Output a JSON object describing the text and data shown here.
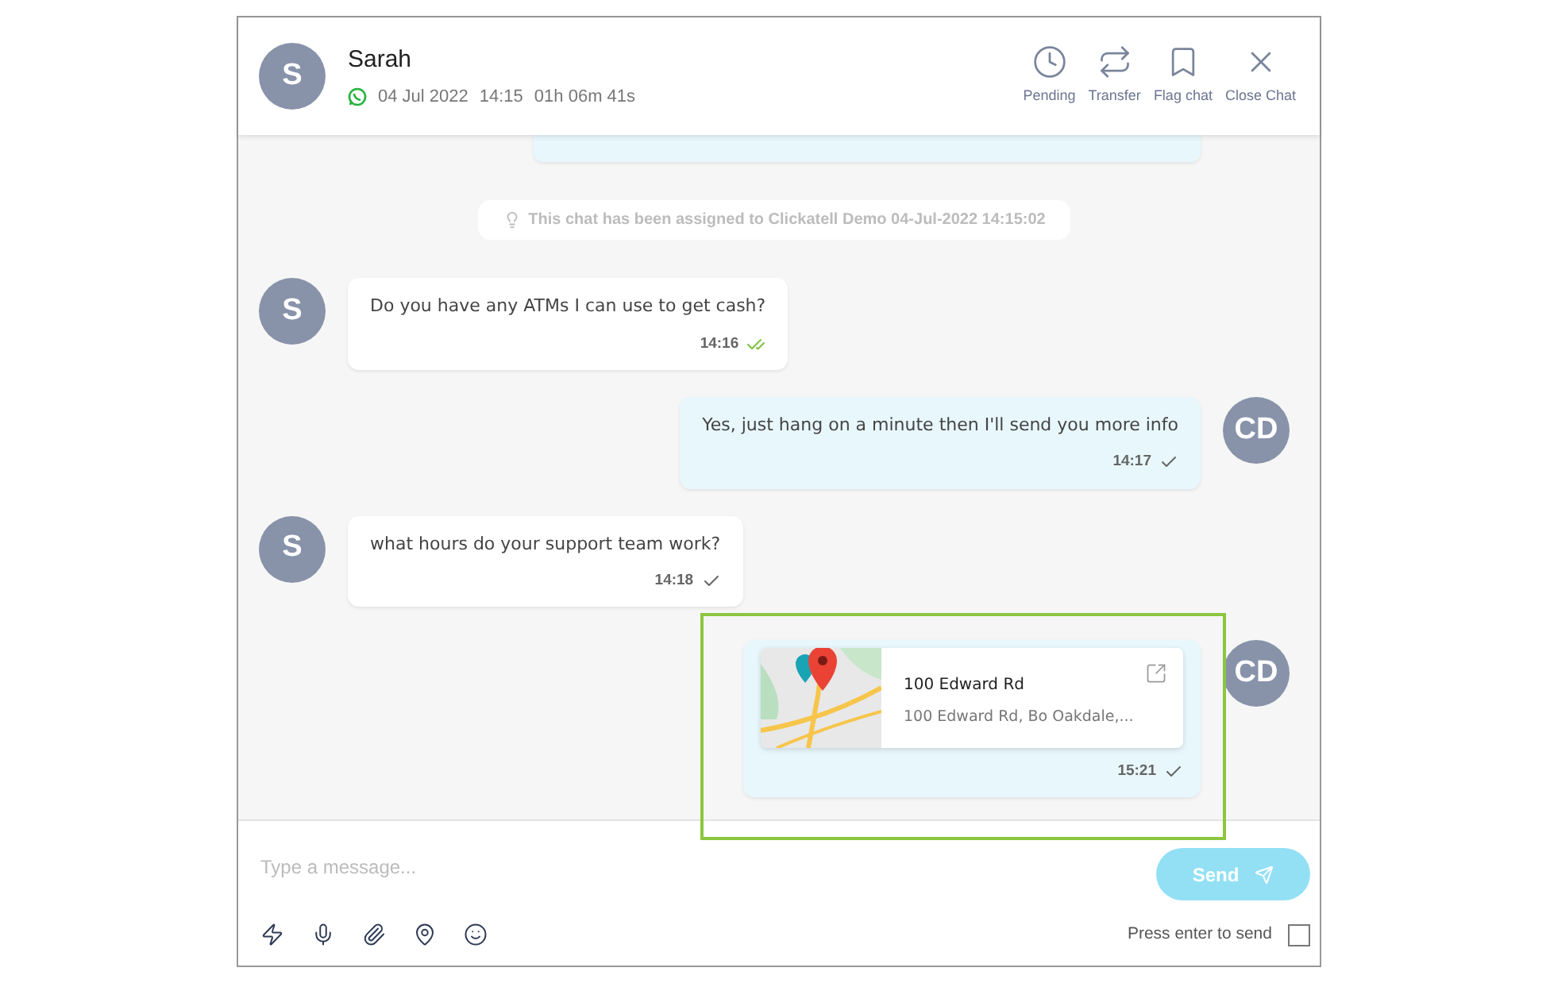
{
  "header": {
    "avatar": "S",
    "name": "Sarah",
    "date": "04 Jul 2022",
    "time": "14:15",
    "duration": "01h 06m 41s",
    "actions": [
      {
        "kind": "pending",
        "label": "Pending"
      },
      {
        "kind": "transfer",
        "label": "Transfer"
      },
      {
        "kind": "flag",
        "label": "Flag chat"
      },
      {
        "kind": "close",
        "label": "Close Chat"
      }
    ]
  },
  "notice": "This chat has been assigned to Clickatell Demo 04-Jul-2022 14:15:02",
  "messages": [
    {
      "kind": "text",
      "outgoing": false,
      "avatar": "S",
      "text": "Do you have any ATMs I can use to get cash?",
      "time": "14:16",
      "read": true
    },
    {
      "kind": "text",
      "outgoing": true,
      "avatar": "CD",
      "text": "Yes, just hang on a minute then I'll send you more info",
      "time": "14:17",
      "read": false
    },
    {
      "kind": "text",
      "outgoing": false,
      "avatar": "S",
      "text": "what hours do your support team work?",
      "time": "14:18",
      "read": false
    },
    {
      "kind": "location",
      "outgoing": true,
      "avatar": "CD",
      "title": "100 Edward Rd",
      "address": "100 Edward Rd, Bo Oakdale,...",
      "time": "15:21",
      "read": false,
      "highlighted": true
    }
  ],
  "composer": {
    "placeholder": "Type a message...",
    "send": "Send",
    "enter_label": "Press enter to send",
    "enter_checked": false
  }
}
